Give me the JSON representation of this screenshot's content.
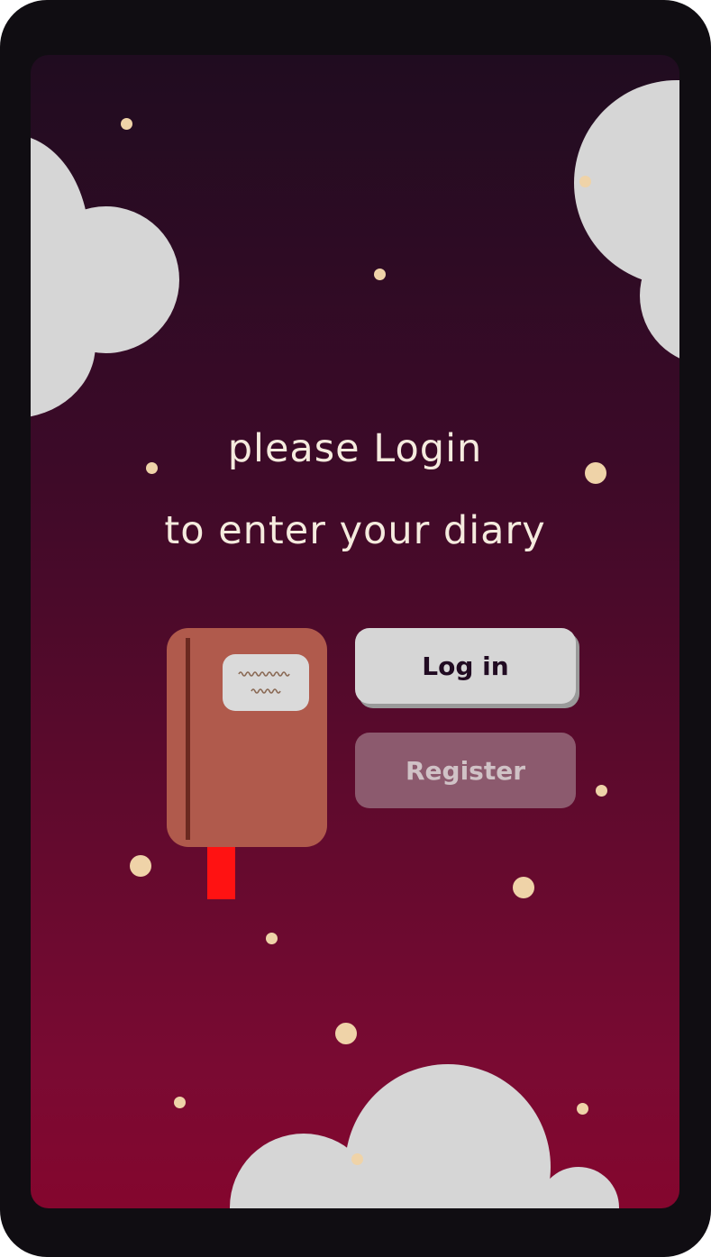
{
  "prompt": {
    "line1": "please Login",
    "line2": "to enter your diary"
  },
  "actions": {
    "login_label": "Log in",
    "register_label": "Register"
  },
  "illustration": {
    "icon": "diary-book-icon",
    "bookmark_color": "#ff1212",
    "cover_color": "#b05a4c"
  },
  "theme": {
    "background_top": "#200c20",
    "background_bottom": "#84062e",
    "cloud_color": "#d6d6d6",
    "star_color": "#efd3a8"
  }
}
